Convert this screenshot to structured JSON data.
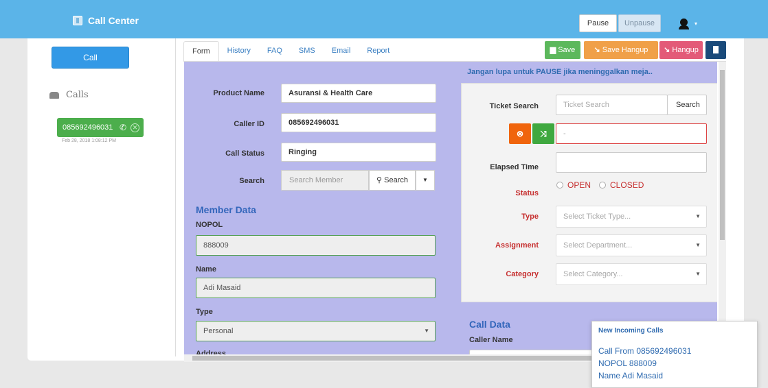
{
  "topbar": {
    "title": "Call Center",
    "pause_label": "Pause",
    "unpause_label": "Unpause"
  },
  "sidebar": {
    "call_button": "Call",
    "calls_header": "Calls",
    "active_call": {
      "number": "085692496031",
      "time": "Feb 28, 2018 1:08:12 PM"
    }
  },
  "tabs": [
    {
      "label": "Form",
      "active": true
    },
    {
      "label": "History"
    },
    {
      "label": "FAQ"
    },
    {
      "label": "SMS"
    },
    {
      "label": "Email"
    },
    {
      "label": "Report"
    }
  ],
  "actions": {
    "save": "Save",
    "save_hangup": "Save Hangup",
    "hangup": "Hangup"
  },
  "form": {
    "product_name_label": "Product Name",
    "product_name_value": "Asuransi & Health Care",
    "caller_id_label": "Caller ID",
    "caller_id_value": "085692496031",
    "call_status_label": "Call Status",
    "call_status_value": "Ringing",
    "search_label": "Search",
    "search_placeholder": "Search Member",
    "search_button": "Search"
  },
  "member": {
    "title": "Member Data",
    "nopol_label": "NOPOL",
    "nopol_value": "888009",
    "name_label": "Name",
    "name_value": "Adi Masaid",
    "type_label": "Type",
    "type_value": "Personal",
    "address_label": "Address"
  },
  "notice": "Jangan lupa untuk PAUSE jika meninggalkan meja..",
  "ticket": {
    "search_label": "Ticket Search",
    "search_placeholder": "Ticket Search",
    "search_button": "Search",
    "ticket_value": "-",
    "elapsed_label": "Elapsed Time",
    "status_label": "Status",
    "status_open": "OPEN",
    "status_closed": "CLOSED",
    "type_label": "Type",
    "type_placeholder": "Select Ticket Type...",
    "assignment_label": "Assignment",
    "assignment_placeholder": "Select Department...",
    "category_label": "Category",
    "category_placeholder": "Select Category..."
  },
  "call_data": {
    "title": "Call Data",
    "caller_name_label": "Caller Name"
  },
  "toast": {
    "title": "New Incoming Calls",
    "line1": "Call From 085692496031",
    "line2": "NOPOL 888009",
    "line3": "Name Adi Masaid"
  },
  "colors": {
    "topbar": "#5bb4e8",
    "content_bg": "#b8b8ec",
    "save": "#5cb85c",
    "save_hangup": "#f0a048",
    "hangup": "#e35a78"
  }
}
